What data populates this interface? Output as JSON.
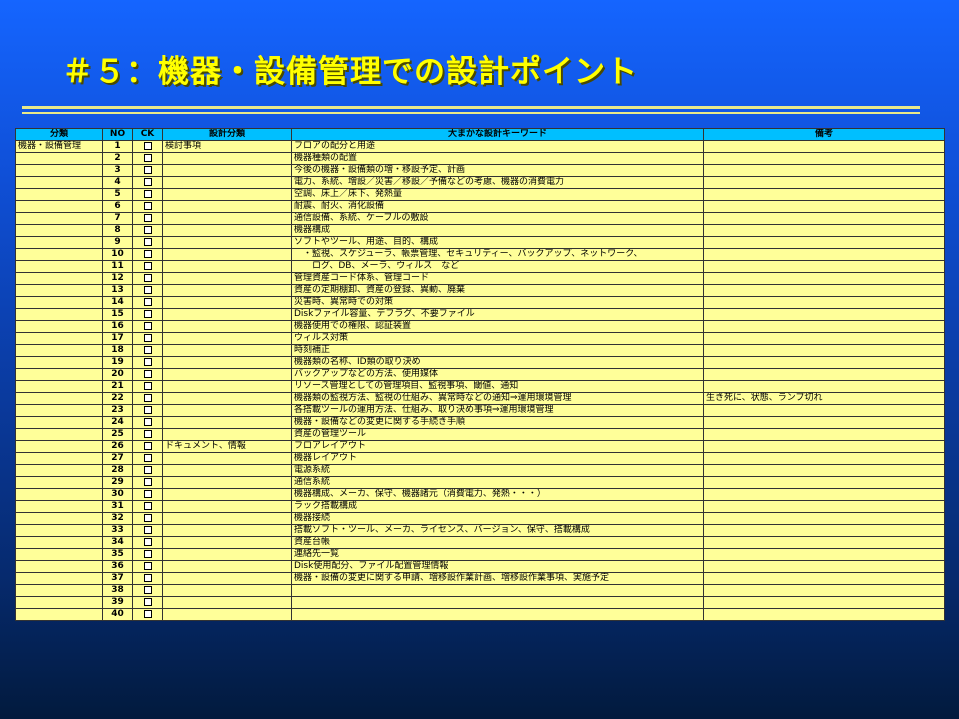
{
  "title": "＃５：機器・設備管理での設計ポイント",
  "table": {
    "headers": [
      "分類",
      "NO",
      "CK",
      "設計分類",
      "大まかな設計キーワード",
      "備考"
    ],
    "rows": [
      {
        "cat": "機器・設備管理",
        "no": "1",
        "sub": "検討事項",
        "kw": "フロアの配分と用途",
        "note": ""
      },
      {
        "cat": "",
        "no": "2",
        "sub": "",
        "kw": "機器種類の配置",
        "note": ""
      },
      {
        "cat": "",
        "no": "3",
        "sub": "",
        "kw": "今後の機器・設備類の増・移設予定、計画",
        "note": ""
      },
      {
        "cat": "",
        "no": "4",
        "sub": "",
        "kw": "電力、系統、増設／災害／移設／予備などの考慮、機器の消費電力",
        "note": ""
      },
      {
        "cat": "",
        "no": "5",
        "sub": "",
        "kw": "空調、床上／床下、発熱量",
        "note": ""
      },
      {
        "cat": "",
        "no": "6",
        "sub": "",
        "kw": "耐震、耐火、消化設備",
        "note": ""
      },
      {
        "cat": "",
        "no": "7",
        "sub": "",
        "kw": "通信設備、系統、ケーブルの敷設",
        "note": ""
      },
      {
        "cat": "",
        "no": "8",
        "sub": "",
        "kw": "機器構成",
        "note": ""
      },
      {
        "cat": "",
        "no": "9",
        "sub": "",
        "kw": "ソフトやツール、用途、目的、構成",
        "note": ""
      },
      {
        "cat": "",
        "no": "10",
        "sub": "",
        "kw": "　・監視、スケジューラ、帳票管理、セキュリティー、バックアップ、ネットワーク、",
        "note": ""
      },
      {
        "cat": "",
        "no": "11",
        "sub": "",
        "kw": "　　ログ、DB、メーラ、ウィルス　など",
        "note": ""
      },
      {
        "cat": "",
        "no": "12",
        "sub": "",
        "kw": "管理資産コード体系、管理コード",
        "note": ""
      },
      {
        "cat": "",
        "no": "13",
        "sub": "",
        "kw": "資産の定期棚卸、資産の登録、異動、廃棄",
        "note": ""
      },
      {
        "cat": "",
        "no": "14",
        "sub": "",
        "kw": "災害時、異常時での対策",
        "note": ""
      },
      {
        "cat": "",
        "no": "15",
        "sub": "",
        "kw": "Diskファイル容量、デフラグ、不要ファイル",
        "note": ""
      },
      {
        "cat": "",
        "no": "16",
        "sub": "",
        "kw": "機器使用での権限、認証装置",
        "note": ""
      },
      {
        "cat": "",
        "no": "17",
        "sub": "",
        "kw": "ウィルス対策",
        "note": ""
      },
      {
        "cat": "",
        "no": "18",
        "sub": "",
        "kw": "時刻補正",
        "note": ""
      },
      {
        "cat": "",
        "no": "19",
        "sub": "",
        "kw": "機器類の名称、ID類の取り決め",
        "note": ""
      },
      {
        "cat": "",
        "no": "20",
        "sub": "",
        "kw": "バックアップなどの方法、使用媒体",
        "note": ""
      },
      {
        "cat": "",
        "no": "21",
        "sub": "",
        "kw": "リソース管理としての管理項目、監視事項、閾値、通知",
        "note": ""
      },
      {
        "cat": "",
        "no": "22",
        "sub": "",
        "kw": "機器類の監視方法、監視の仕組み、異常時などの通知⇒運用環境管理",
        "note": "生き死に、状態、ランプ切れ"
      },
      {
        "cat": "",
        "no": "23",
        "sub": "",
        "kw": "各搭載ツールの運用方法、仕組み、取り決め事項⇒運用環境管理",
        "note": ""
      },
      {
        "cat": "",
        "no": "24",
        "sub": "",
        "kw": "機器・設備などの変更に関する手続き手順",
        "note": ""
      },
      {
        "cat": "",
        "no": "25",
        "sub": "",
        "kw": "資産の管理ツール",
        "note": ""
      },
      {
        "cat": "",
        "no": "26",
        "sub": "ドキュメント、情報",
        "kw": "フロアレイアウト",
        "note": ""
      },
      {
        "cat": "",
        "no": "27",
        "sub": "",
        "kw": "機器レイアウト",
        "note": ""
      },
      {
        "cat": "",
        "no": "28",
        "sub": "",
        "kw": "電源系統",
        "note": ""
      },
      {
        "cat": "",
        "no": "29",
        "sub": "",
        "kw": "通信系統",
        "note": ""
      },
      {
        "cat": "",
        "no": "30",
        "sub": "",
        "kw": "機器構成、メーカ、保守、機器諸元（消費電力、発熱・・・）",
        "note": ""
      },
      {
        "cat": "",
        "no": "31",
        "sub": "",
        "kw": "ラック搭載構成",
        "note": ""
      },
      {
        "cat": "",
        "no": "32",
        "sub": "",
        "kw": "機器接続",
        "note": ""
      },
      {
        "cat": "",
        "no": "33",
        "sub": "",
        "kw": "搭載ソフト・ツール、メーカ、ライセンス、バージョン、保守、搭載構成",
        "note": ""
      },
      {
        "cat": "",
        "no": "34",
        "sub": "",
        "kw": "資産台帳",
        "note": ""
      },
      {
        "cat": "",
        "no": "35",
        "sub": "",
        "kw": "連絡先一覧",
        "note": ""
      },
      {
        "cat": "",
        "no": "36",
        "sub": "",
        "kw": "Disk使用配分、ファイル配置管理情報",
        "note": ""
      },
      {
        "cat": "",
        "no": "37",
        "sub": "",
        "kw": "機器・設備の変更に関する申請、増移設作業計画、増移設作業事項、実施予定",
        "note": ""
      },
      {
        "cat": "",
        "no": "38",
        "sub": "",
        "kw": "",
        "note": ""
      },
      {
        "cat": "",
        "no": "39",
        "sub": "",
        "kw": "",
        "note": ""
      },
      {
        "cat": "",
        "no": "40",
        "sub": "",
        "kw": "",
        "note": ""
      }
    ]
  }
}
